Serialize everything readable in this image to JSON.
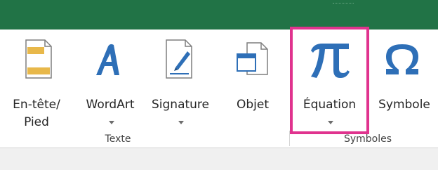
{
  "groups": {
    "texte": {
      "label": "Texte",
      "buttons": [
        {
          "line1": "En-tête/",
          "line2": "Pied"
        },
        {
          "line1": "WordArt"
        },
        {
          "line1": "Signature"
        },
        {
          "line1": "Objet"
        }
      ]
    },
    "symboles": {
      "label": "Symboles",
      "buttons": [
        {
          "line1": "Équation"
        },
        {
          "line1": "Symbole"
        }
      ]
    }
  },
  "colors": {
    "titlebar": "#217346",
    "highlight": "#e0338e",
    "icon_blue": "#2e6fb7",
    "icon_gold": "#e8b84a"
  }
}
